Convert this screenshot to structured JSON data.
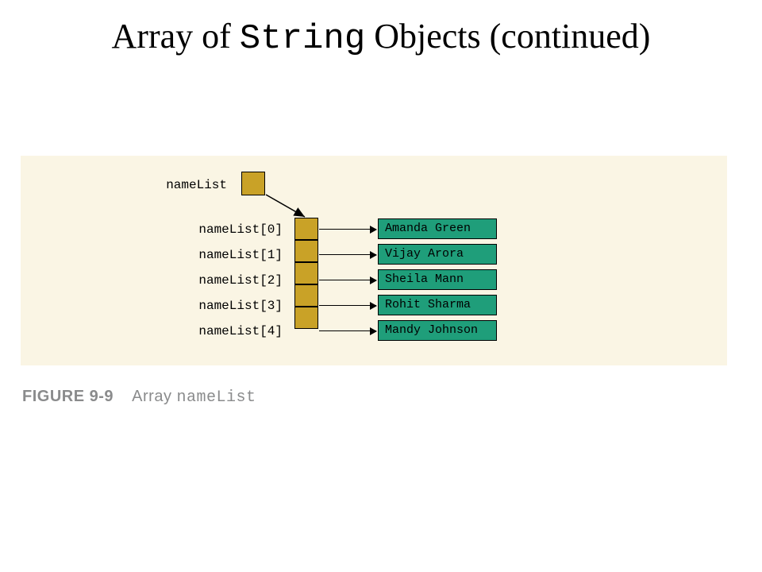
{
  "title": {
    "prefix": "Array of ",
    "mono": "String",
    "suffix": " Objects (continued)"
  },
  "figure": {
    "ref_label": "nameList",
    "elements": [
      {
        "label": "nameList[0]",
        "value": "Amanda Green"
      },
      {
        "label": "nameList[1]",
        "value": "Vijay Arora"
      },
      {
        "label": "nameList[2]",
        "value": "Sheila Mann"
      },
      {
        "label": "nameList[3]",
        "value": "Rohit Sharma"
      },
      {
        "label": "nameList[4]",
        "value": "Mandy Johnson"
      }
    ]
  },
  "caption": {
    "tag": "FIGURE 9-9",
    "text_prefix": "Array ",
    "mono": "nameList"
  },
  "colors": {
    "panel_bg": "#faf5e4",
    "array_box": "#c9a227",
    "string_box": "#1f9e7a"
  }
}
